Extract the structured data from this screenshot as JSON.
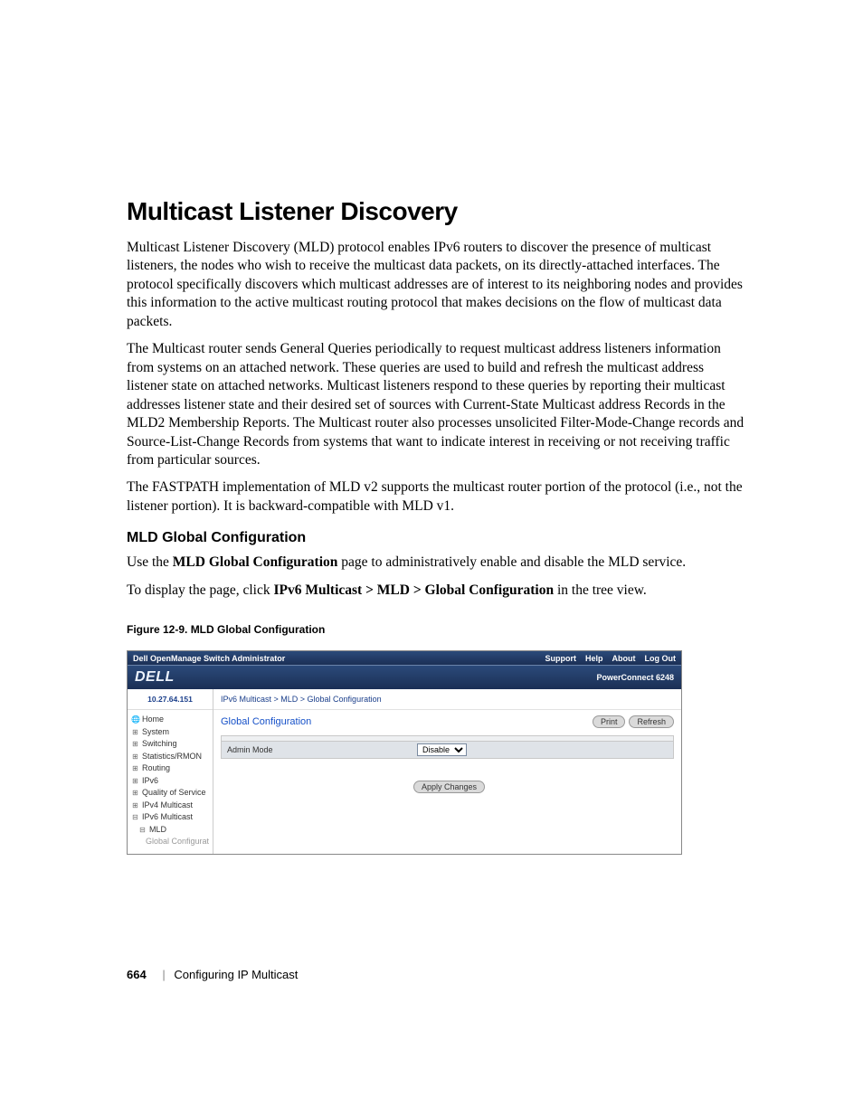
{
  "doc": {
    "h1": "Multicast Listener Discovery",
    "p1": "Multicast Listener Discovery (MLD) protocol enables IPv6 routers to discover the presence of multicast listeners, the nodes who wish to receive the multicast data packets, on its directly-attached interfaces. The protocol specifically discovers which multicast addresses are of interest to its neighboring nodes and provides this information to the active multicast routing protocol that makes decisions on the flow of multicast data packets.",
    "p2": "The Multicast router sends General Queries periodically to request multicast address listeners information from systems on an attached network. These queries are used to build and refresh the multicast address listener state on attached networks. Multicast listeners respond to these queries by reporting their multicast addresses listener state and their desired set of sources with Current-State Multicast address Records in the MLD2 Membership Reports. The Multicast router also processes unsolicited Filter-Mode-Change records and Source-List-Change Records from systems that want to indicate interest in receiving or not receiving traffic from particular sources.",
    "p3": "The FASTPATH implementation of MLD v2 supports the multicast router portion of the protocol (i.e., not the listener portion). It is backward-compatible with MLD v1.",
    "h2": "MLD Global Configuration",
    "p4_pre": "Use the ",
    "p4_bold": "MLD Global Configuration",
    "p4_post": " page to administratively enable and disable the MLD service.",
    "p5_pre": "To display the page, click ",
    "p5_bold": "IPv6 Multicast > MLD > Global Configuration",
    "p5_post": " in the tree view.",
    "figcap": "Figure 12-9.    MLD Global Configuration"
  },
  "ss": {
    "appTitle": "Dell OpenManage Switch Administrator",
    "top": {
      "support": "Support",
      "help": "Help",
      "about": "About",
      "logout": "Log Out"
    },
    "logo": "DELL",
    "model": "PowerConnect 6248",
    "ip": "10.27.64.151",
    "nav": {
      "home": "Home",
      "system": "System",
      "switching": "Switching",
      "stats": "Statistics/RMON",
      "routing": "Routing",
      "ipv6": "IPv6",
      "qos": "Quality of Service",
      "ipv4m": "IPv4 Multicast",
      "ipv6m": "IPv6 Multicast",
      "mld": "MLD",
      "globalconf": "Global Configurat"
    },
    "breadcrumb": "IPv6 Multicast > MLD > Global Configuration",
    "title": "Global Configuration",
    "print": "Print",
    "refresh": "Refresh",
    "adminMode": "Admin Mode",
    "disable": "Disable",
    "apply": "Apply Changes"
  },
  "footer": {
    "pnum": "664",
    "chapter": "Configuring IP Multicast"
  }
}
